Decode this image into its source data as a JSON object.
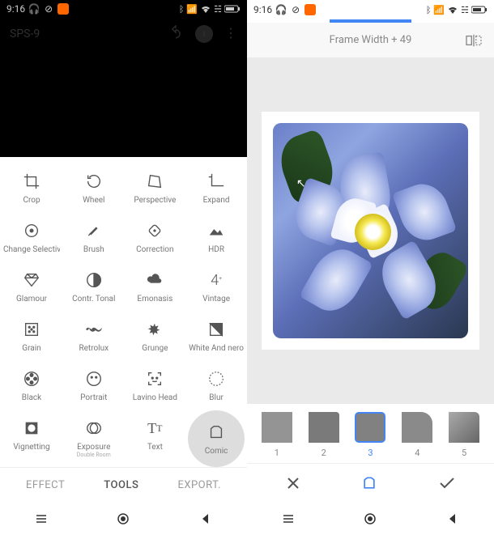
{
  "status": {
    "time": "9:16",
    "icons_left": [
      "headphones-icon",
      "dnd-icon",
      "badge-icon"
    ],
    "icons_right": [
      "bluetooth-icon",
      "signal-icon",
      "wifi-icon",
      "volte-icon",
      "battery-icon"
    ]
  },
  "left": {
    "header_title": "SPS-9",
    "tools": [
      {
        "name": "crop",
        "label": "Crop"
      },
      {
        "name": "wheel",
        "label": "Wheel"
      },
      {
        "name": "perspective",
        "label": "Perspective"
      },
      {
        "name": "expand",
        "label": "Expand"
      },
      {
        "name": "selective",
        "label": "Change Selective"
      },
      {
        "name": "brush",
        "label": "Brush"
      },
      {
        "name": "correction",
        "label": "Correction"
      },
      {
        "name": "hdr",
        "label": "HDR"
      },
      {
        "name": "glamour",
        "label": "Glamour"
      },
      {
        "name": "tonal",
        "label": "Contr. Tonal"
      },
      {
        "name": "emphasis",
        "label": "Emonasis"
      },
      {
        "name": "vintage",
        "label": "Vintage"
      },
      {
        "name": "grain",
        "label": "Grain"
      },
      {
        "name": "retrolux",
        "label": "Retrolux"
      },
      {
        "name": "grunge",
        "label": "Grunge"
      },
      {
        "name": "whiteand",
        "label": "White And nero"
      },
      {
        "name": "black",
        "label": "Black"
      },
      {
        "name": "portrait",
        "label": "Portrait"
      },
      {
        "name": "headpose",
        "label": "Lavino Head"
      },
      {
        "name": "blur",
        "label": "Blur"
      },
      {
        "name": "vignette",
        "label": "Vignetting"
      },
      {
        "name": "exposure",
        "label": "Exposure",
        "sublabel": "Double Room"
      },
      {
        "name": "text",
        "label": "Text"
      },
      {
        "name": "comic",
        "label": "Comic",
        "highlighted": true
      }
    ],
    "tabs": {
      "effect": "EFFECT",
      "tools": "TOOLS",
      "export": "EXPORT."
    }
  },
  "right": {
    "frame_label": "Frame Width + 49",
    "frames": [
      {
        "num": "1"
      },
      {
        "num": "2"
      },
      {
        "num": "3",
        "active": true
      },
      {
        "num": "4"
      },
      {
        "num": "5"
      }
    ]
  },
  "nav": [
    "menu",
    "home",
    "back"
  ]
}
